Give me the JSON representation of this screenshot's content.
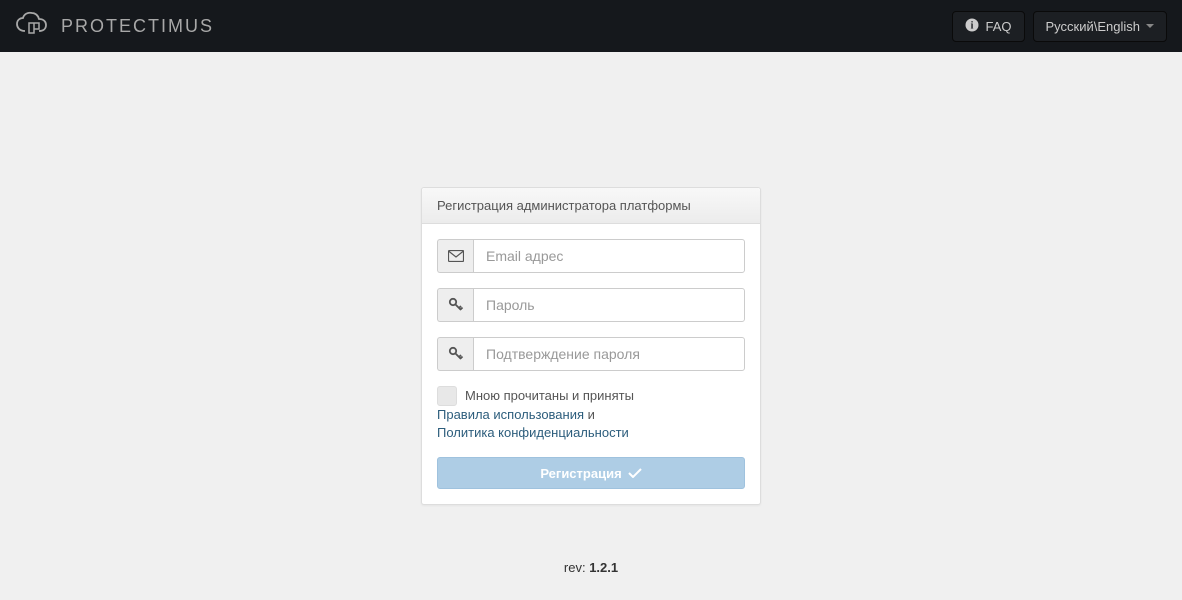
{
  "header": {
    "brand": "PROTECTIMUS",
    "faq_label": "FAQ",
    "lang_label": "Русский\\English"
  },
  "panel": {
    "title": "Регистрация администратора платформы",
    "email_placeholder": "Email адрес",
    "password_placeholder": "Пароль",
    "password_confirm_placeholder": "Подтверждение пароля",
    "terms_intro": "Мною прочитаны и приняты",
    "terms_link": "Правила использования",
    "terms_and": " и ",
    "privacy_link": "Политика конфиденциальности",
    "submit_label": "Регистрация"
  },
  "footer": {
    "rev_prefix": "rev: ",
    "rev_value": "1.2.1"
  }
}
